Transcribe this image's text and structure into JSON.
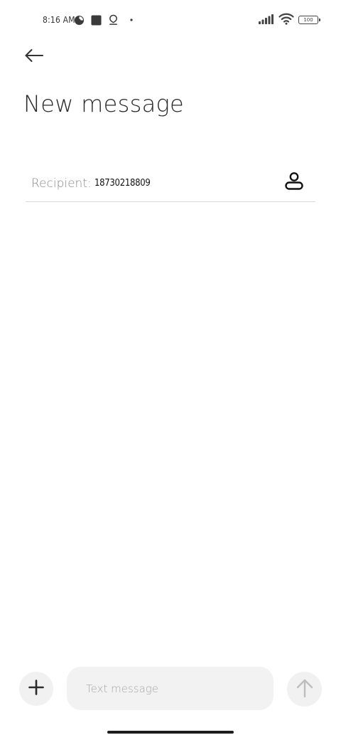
{
  "status_bar": {
    "time": "8:16 AM",
    "battery_level": "100",
    "left_icons": [
      "pie-app-icon",
      "square-app-icon",
      "location-icon",
      "dot-icon"
    ],
    "right_icons": [
      "signal-icon",
      "wifi-icon",
      "battery-icon"
    ]
  },
  "header": {
    "back_icon": "arrow-left-icon",
    "title": "New message"
  },
  "recipient": {
    "label": "Recipient:",
    "value": "18730218809",
    "contact_icon": "person-icon"
  },
  "compose": {
    "attach_icon": "plus-icon",
    "input_value": "",
    "input_placeholder": "Text message",
    "send_icon": "arrow-up-icon"
  },
  "colors": {
    "background": "#ffffff",
    "text_primary": "#2a2a2a",
    "text_muted": "#8a8a8a",
    "input_bg": "#f2f2f2",
    "button_bg": "#f1f1f1",
    "divider": "#d9d9d9"
  }
}
